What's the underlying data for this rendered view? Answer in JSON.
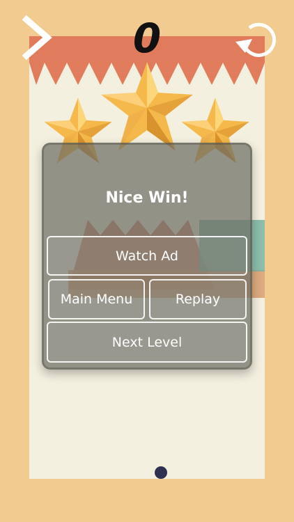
{
  "hud": {
    "score": "0",
    "next_icon": "chevron-right-icon",
    "restart_icon": "restart-icon"
  },
  "result": {
    "stars_earned": 3,
    "stars_total": 3,
    "title": "Nice Win!"
  },
  "buttons": {
    "watch_ad": "Watch Ad",
    "main_menu": "Main Menu",
    "replay": "Replay",
    "next_level": "Next Level"
  },
  "colors": {
    "background": "#f1cb90",
    "board": "#f4f0e0",
    "spikes": "#e07b5c",
    "star": "#f4b94a",
    "player": "#2f3150"
  }
}
